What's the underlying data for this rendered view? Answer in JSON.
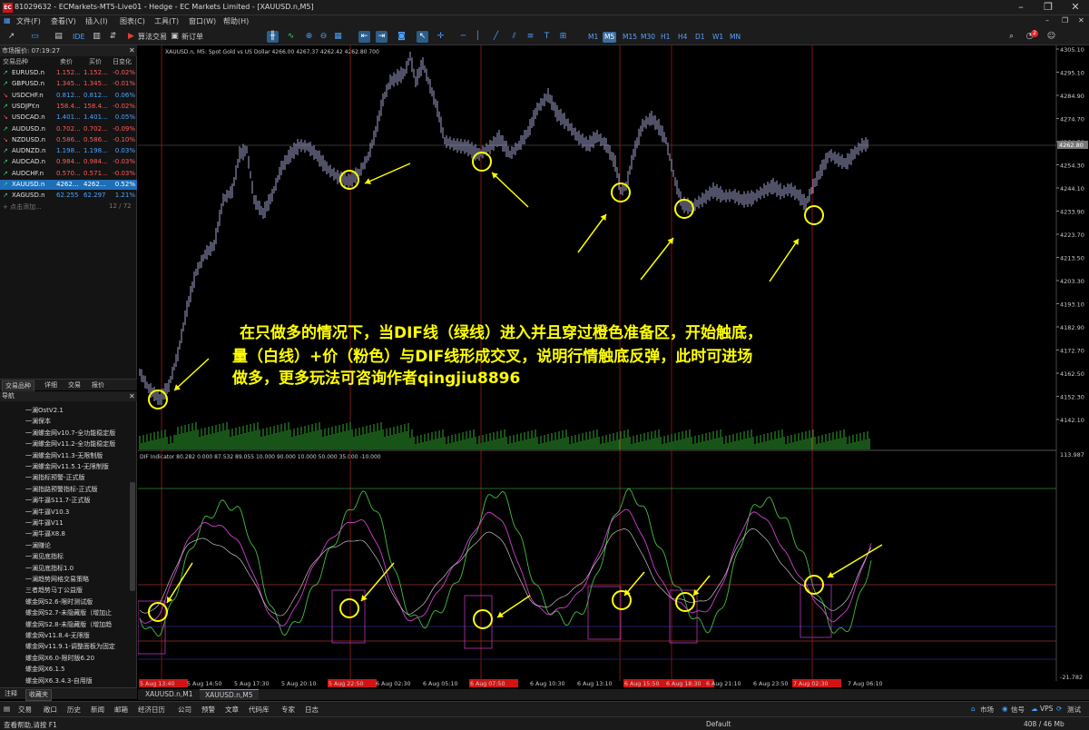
{
  "window": {
    "title": "81029632 - ECMarkets-MT5-Live01 - Hedge - EC Markets Limited - [XAUUSD.n,M5]",
    "logo": "EC",
    "min": "–",
    "max": "❐",
    "close": "✕"
  },
  "menu": [
    "文件(F)",
    "查看(V)",
    "插入(I)",
    "图表(C)",
    "工具(T)",
    "窗口(W)",
    "帮助(H)"
  ],
  "toolbar": {
    "ide": "IDE",
    "algo_trading": "算法交易",
    "new_order": "新订单",
    "timeframes": [
      "M1",
      "M5",
      "M15",
      "M30",
      "H1",
      "H4",
      "D1",
      "W1",
      "MN"
    ],
    "active_timeframe": "M5",
    "notification_count": "2"
  },
  "market_watch": {
    "title": "市场报价: 07:19:27",
    "columns": [
      "交易品种",
      "卖价",
      "买价",
      "日变化"
    ],
    "rows": [
      {
        "symbol": "EURUSD.n",
        "bid": "1.152...",
        "ask": "1.152...",
        "change": "-0.02%",
        "dir": "up"
      },
      {
        "symbol": "GBPUSD.n",
        "bid": "1.345...",
        "ask": "1.345...",
        "change": "-0.01%",
        "dir": "up"
      },
      {
        "symbol": "USDCHF.n",
        "bid": "0.812...",
        "ask": "0.812...",
        "change": "0.06%",
        "dir": "down"
      },
      {
        "symbol": "USDJPY.n",
        "bid": "158.4...",
        "ask": "158.4...",
        "change": "-0.02%",
        "dir": "up"
      },
      {
        "symbol": "USDCAD.n",
        "bid": "1.401...",
        "ask": "1.401...",
        "change": "0.05%",
        "dir": "down"
      },
      {
        "symbol": "AUDUSD.n",
        "bid": "0.702...",
        "ask": "0.702...",
        "change": "-0.09%",
        "dir": "up"
      },
      {
        "symbol": "NZDUSD.n",
        "bid": "0.586...",
        "ask": "0.586...",
        "change": "-0.10%",
        "dir": "down"
      },
      {
        "symbol": "AUDNZD.n",
        "bid": "1.198...",
        "ask": "1.198...",
        "change": "0.03%",
        "dir": "up"
      },
      {
        "symbol": "AUDCAD.n",
        "bid": "0.984...",
        "ask": "0.984...",
        "change": "-0.03%",
        "dir": "up"
      },
      {
        "symbol": "AUDCHF.n",
        "bid": "0.570...",
        "ask": "0.571...",
        "change": "-0.03%",
        "dir": "up"
      },
      {
        "symbol": "XAUUSD.n",
        "bid": "4262...",
        "ask": "4262...",
        "change": "0.52%",
        "dir": "up",
        "selected": true
      },
      {
        "symbol": "XAGUSD.n",
        "bid": "62.255",
        "ask": "62.297",
        "change": "1.21%",
        "dir": "up"
      }
    ],
    "add_label": "+ 点击添加...",
    "count": "12 / 72",
    "tabs": [
      "交易品种",
      "详细",
      "交易",
      "报价"
    ]
  },
  "navigator": {
    "title": "导航",
    "items": [
      "一澜OstV2.1",
      "一澜保本",
      "一澜螺金网v10.7-全功能稳定版",
      "一澜螺金网v11.2-全功能稳定版",
      "一澜螺金网v11.3-无限制版",
      "一澜螺金网v11.5.1-无限制版",
      "一澜指标预警-正式版",
      "一澜指路预警指标-正式版",
      "一澜牛逼S11.7-正式版",
      "一澜牛逼V10.3",
      "一澜牛逼V11",
      "一澜牛逼X8.8",
      "一澜赚论",
      "一澜见底指标",
      "一澜见底指标1.0",
      "一澜趋势网格交易策略",
      "三者趋势马丁公益版",
      "螺金网S2.6-限时测试版",
      "螺金网S2.7-未隐藏版（增加止",
      "螺金网S2.8-未隐藏版（增加趋",
      "螺金网v11.8.4-无限版",
      "螺金网v11.9.1-调整面板为固定",
      "螺金网X6.0-限时版6.20",
      "螺金网X6.1.5",
      "螺金网X6.3.4.3-自用版"
    ],
    "tabs": [
      "注释",
      "收藏夹"
    ]
  },
  "chart": {
    "header": "XAUUSD.n, M5:  Spot Gold vs US Dollar  4266.00 4267.37 4262.42 4262.80  700",
    "indicator_header": "DIF Indicator 80.282 0.000 87.532 89.055 10.000 90.000 10.000 50.000 35.000 -10.000",
    "price_ticks": [
      "4305.10",
      "4295.10",
      "4284.90",
      "4274.70",
      "4264.50",
      "4254.30",
      "4244.10",
      "4233.90",
      "4223.70",
      "4213.50",
      "4203.30",
      "4193.10",
      "4182.90",
      "4172.70",
      "4162.50",
      "4152.30",
      "4142.10"
    ],
    "current_price": "4262.80",
    "ind_ticks": [
      "113.987",
      "-21.782"
    ],
    "time_labels": [
      "5 Aug 13:40",
      "5 Aug 14:50",
      "5 Aug 17:30",
      "5 Aug 20:10",
      "5 Aug 22:50",
      "6 Aug 02:30",
      "6 Aug 05:10",
      "6 Aug 07:50",
      "6 Aug 10:30",
      "6 Aug 13:10",
      "6 Aug 15:50",
      "6 Aug 18:30",
      "6 Aug 21:10",
      "6 Aug 23:50",
      "7 Aug 02:30",
      "7 Aug 06:10"
    ],
    "red_time_labels": [
      "5 Aug 13:40",
      "5 Aug 22:50",
      "6 Aug 07:50",
      "6 Aug 15:50",
      "6 Aug 18:30",
      "7 Aug 02:30"
    ],
    "annotation": [
      "在只做多的情况下，当DIF线（绿线）进入并且穿过橙色准备区，开始触底，",
      "量（白线）+价（粉色）与DIF线形成交叉，说明行情触底反弹，此时可进场",
      "做多，更多玩法可咨询作者qingjiu8896"
    ],
    "tabs": [
      "XAUUSD.n,M1",
      "XAUUSD.n,M5"
    ],
    "colors": {
      "candle": "#c8c8ff",
      "volume": "#2fa82f",
      "dif": "#40c040",
      "pink": "#d040d0",
      "marker": "#ffff00",
      "vline": "#a01818"
    }
  },
  "bottom_tabs": [
    "交易",
    "敞口",
    "历史",
    "新闻",
    "邮箱",
    "经济日历",
    "公司",
    "预警",
    "文章",
    "代码库",
    "专家",
    "日志"
  ],
  "bottom_right": [
    "市场",
    "信号",
    "VPS",
    "测试"
  ],
  "status": {
    "help": "查看帮助,请按 F1",
    "profile": "Default",
    "memory": "408 / 46 Mb"
  }
}
